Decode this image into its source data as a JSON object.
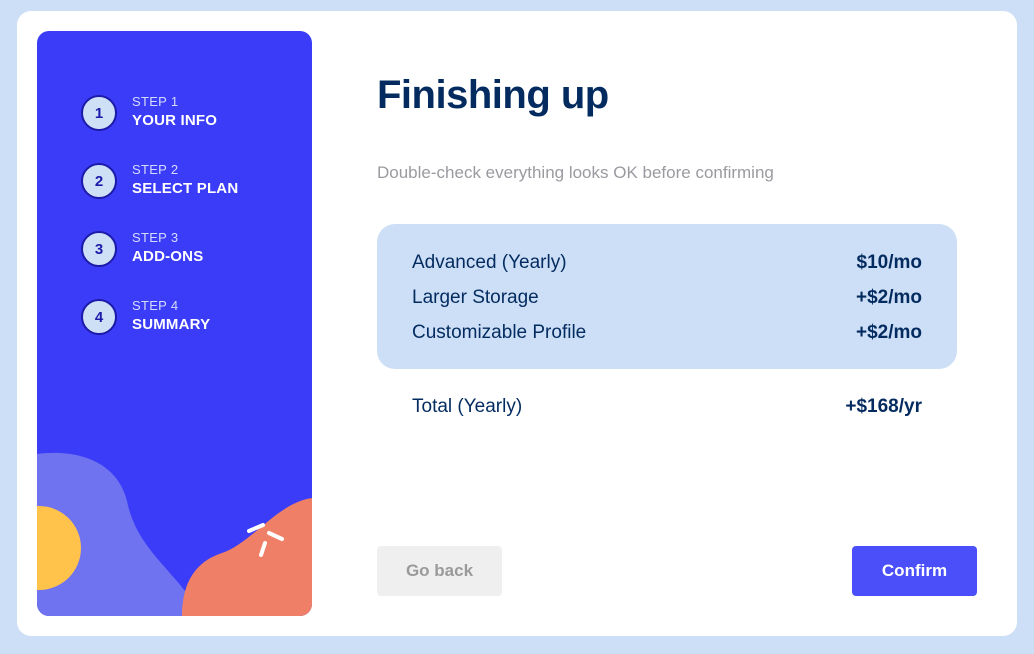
{
  "sidebar": {
    "steps": [
      {
        "number": "1",
        "label": "STEP 1",
        "title": "YOUR INFO"
      },
      {
        "number": "2",
        "label": "STEP 2",
        "title": "SELECT PLAN"
      },
      {
        "number": "3",
        "label": "STEP 3",
        "title": "ADD-ONS"
      },
      {
        "number": "4",
        "label": "STEP 4",
        "title": "SUMMARY"
      }
    ]
  },
  "main": {
    "title": "Finishing up",
    "subtitle": "Double-check everything looks OK before confirming",
    "summary": {
      "items": [
        {
          "name": "Advanced (Yearly)",
          "price": "$10/mo"
        },
        {
          "name": "Larger Storage",
          "price": "+$2/mo"
        },
        {
          "name": "Customizable Profile",
          "price": "+$2/mo"
        }
      ]
    },
    "total": {
      "label": "Total (Yearly)",
      "price": "+$168/yr"
    },
    "buttons": {
      "back": "Go back",
      "confirm": "Confirm"
    }
  },
  "colors": {
    "page_bg": "#cddff6",
    "sidebar_bg": "#3b3cf7",
    "accent": "#4a4ffa",
    "text_dark": "#032b5f",
    "muted": "#9a9aa0"
  }
}
